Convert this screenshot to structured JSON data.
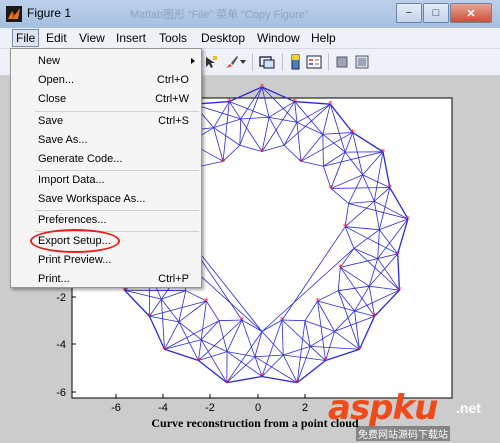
{
  "window": {
    "title": "Figure 1",
    "title_ghost": "Matlab图形 “File” 菜单 “Copy Figure”",
    "minimize": "−",
    "maximize": "□",
    "close": "✕"
  },
  "menubar": [
    "File",
    "Edit",
    "View",
    "Insert",
    "Tools",
    "Desktop",
    "Window",
    "Help"
  ],
  "file_menu": {
    "items": [
      {
        "label": "New",
        "shortcut": "",
        "submenu": true
      },
      {
        "label": "Open...",
        "shortcut": "Ctrl+O"
      },
      {
        "label": "Close",
        "shortcut": "Ctrl+W"
      },
      {
        "label": "Save",
        "shortcut": "Ctrl+S"
      },
      {
        "label": "Save As...",
        "shortcut": ""
      },
      {
        "label": "Generate Code...",
        "shortcut": ""
      },
      {
        "label": "Import Data...",
        "shortcut": ""
      },
      {
        "label": "Save Workspace As...",
        "shortcut": ""
      },
      {
        "label": "Preferences...",
        "shortcut": ""
      },
      {
        "label": "Export Setup...",
        "shortcut": "",
        "highlighted": true
      },
      {
        "label": "Print Preview...",
        "shortcut": ""
      },
      {
        "label": "Print...",
        "shortcut": "Ctrl+P"
      }
    ]
  },
  "plot": {
    "xlabel": "Curve reconstruction from a point cloud",
    "xticks": [
      "-6",
      "-4",
      "-2",
      "0",
      "2"
    ],
    "yticks": [
      "-2",
      "-4",
      "-6"
    ],
    "line_color": "#2a2ad8",
    "marker_color": "#ff2020"
  },
  "watermark": {
    "main": "aspku",
    "suffix": ".net",
    "sub": "免费网站源码下载站"
  },
  "highlight_color": "#e0231f"
}
